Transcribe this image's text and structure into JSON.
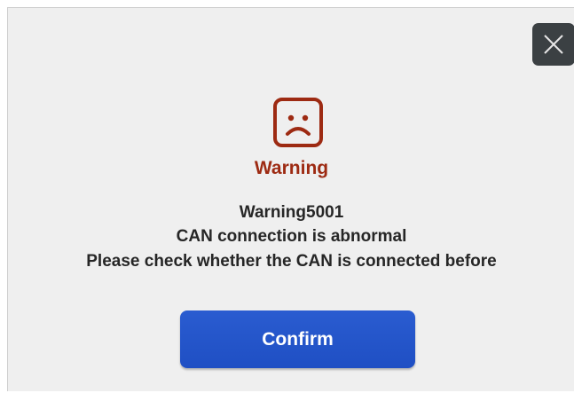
{
  "dialog": {
    "title": "Warning",
    "code": "Warning5001",
    "message_line1": "CAN connection is abnormal",
    "message_line2": "Please check whether the CAN is connected before",
    "confirm_label": "Confirm",
    "icon": "sad-face-icon",
    "close_icon": "close-icon",
    "colors": {
      "warning": "#9d2a12",
      "button": "#2457cb",
      "background": "#efefef",
      "close_button": "#3b4043"
    }
  }
}
